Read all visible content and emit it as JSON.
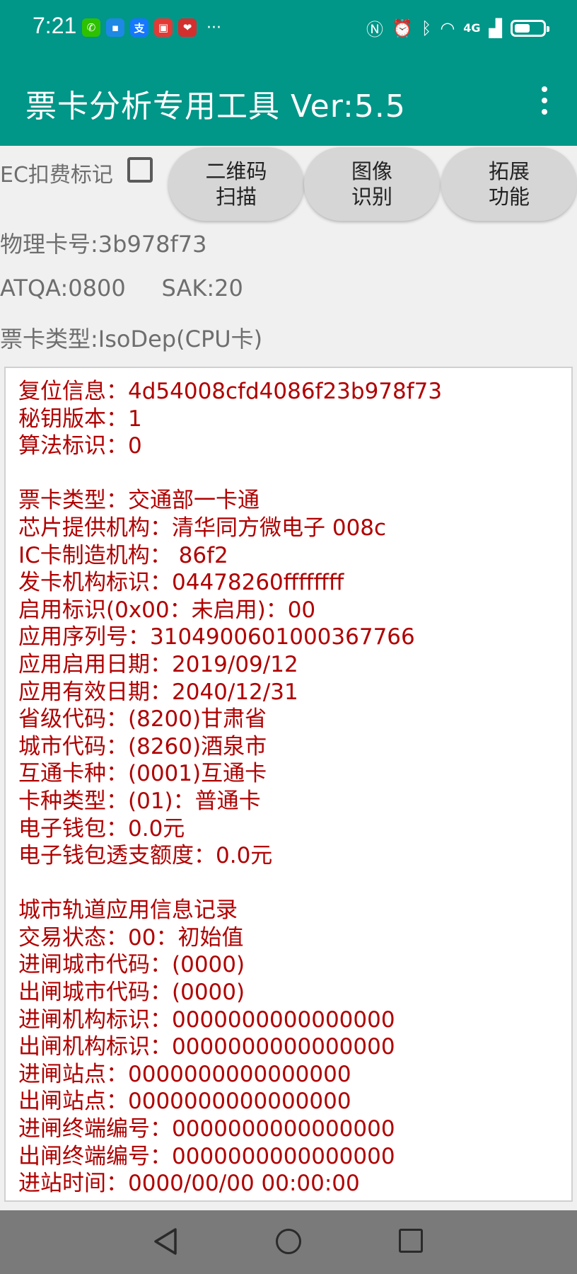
{
  "status_bar": {
    "time": "7:21",
    "notifications": [
      {
        "icon": "wechat-icon",
        "color": "#2dc100",
        "glyph": "✆"
      },
      {
        "icon": "message-icon",
        "color": "#1e88e5",
        "glyph": "▪"
      },
      {
        "icon": "alipay-icon",
        "color": "#1677ff",
        "glyph": "支"
      },
      {
        "icon": "huawei-icon",
        "color": "#e53935",
        "glyph": "▣"
      },
      {
        "icon": "health-app-icon",
        "color": "#d32f2f",
        "glyph": "❤"
      }
    ],
    "more": "···",
    "network_label": "4G",
    "battery_level": 0.55
  },
  "app_bar": {
    "title": "票卡分析专用工具 Ver:5.5"
  },
  "controls": {
    "ec_label": "EC扣费标记",
    "ec_checked": false,
    "qr_button": "二维码\n扫描",
    "image_button": "图像\n识别",
    "extend_button": "拓展\n功能"
  },
  "card_info": {
    "physical_number": "物理卡号:3b978f73",
    "atqa_sak": "ATQA:0800     SAK:20",
    "card_type": "票卡类型:IsoDep(CPU卡)"
  },
  "details": [
    "复位信息：4d54008cfd4086f23b978f73",
    "秘钥版本：1",
    "算法标识：0",
    "",
    "票卡类型：交通部一卡通",
    "芯片提供机构：清华同方微电子 008c",
    "IC卡制造机构： 86f2",
    "发卡机构标识：04478260ffffffff",
    "启用标识(0x00：未启用)：00",
    "应用序列号：3104900601000367766",
    "应用启用日期：2019/09/12",
    "应用有效日期：2040/12/31",
    "省级代码：(8200)甘肃省",
    "城市代码：(8260)酒泉市",
    "互通卡种：(0001)互通卡",
    "卡种类型：(01)：普通卡",
    "电子钱包：0.0元",
    "电子钱包透支额度：0.0元",
    "",
    "城市轨道应用信息记录",
    "交易状态：00：初始值",
    "进闸城市代码：(0000)",
    "出闸城市代码：(0000)",
    "进闸机构标识：0000000000000000",
    "出闸机构标识：0000000000000000",
    "进闸站点：0000000000000000",
    "出闸站点：0000000000000000",
    "进闸终端编号：0000000000000000",
    "出闸终端编号：0000000000000000",
    "进站时间：0000/00/00 00:00:00"
  ]
}
